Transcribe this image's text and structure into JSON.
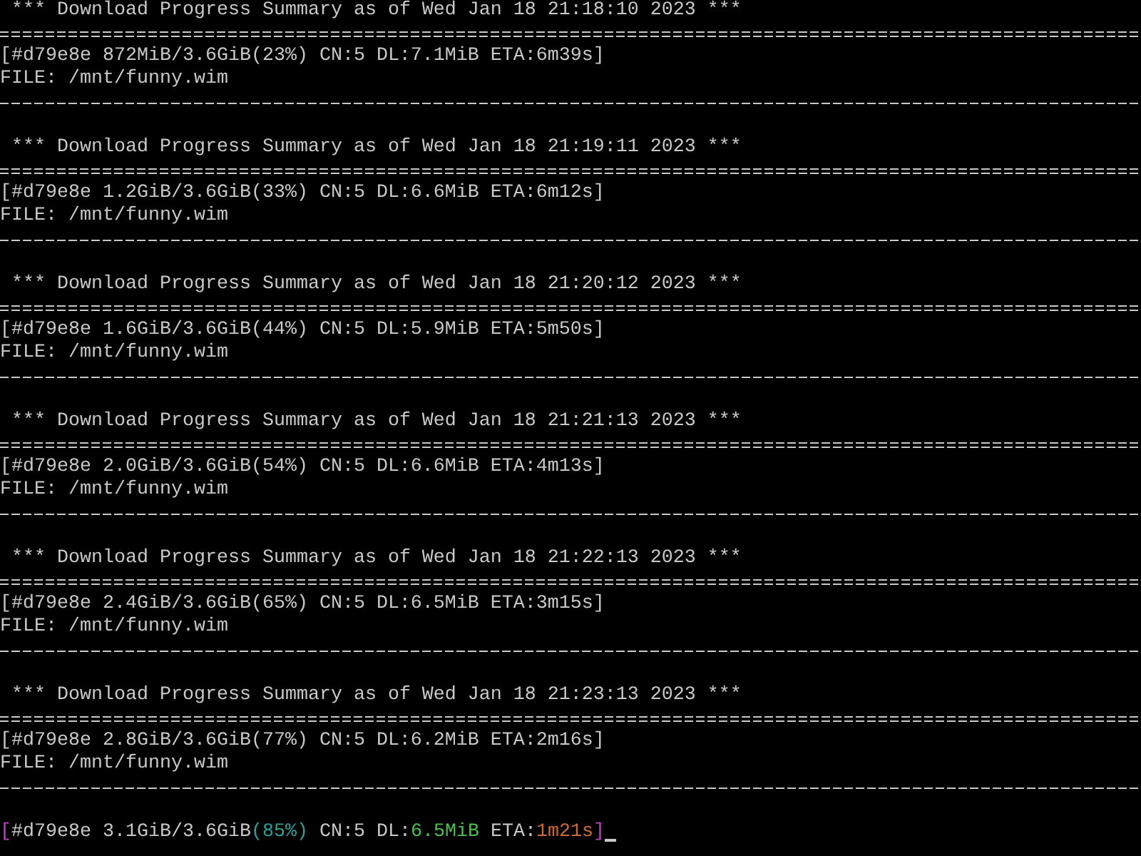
{
  "terminal": {
    "summaries": [
      {
        "header": "*** Download Progress Summary as of Wed Jan 18 21:18:10 2023 ***",
        "status": "[#d79e8e 872MiB/3.6GiB(23%) CN:5 DL:7.1MiB ETA:6m39s]",
        "file": "FILE: /mnt/funny.wim"
      },
      {
        "header": "*** Download Progress Summary as of Wed Jan 18 21:19:11 2023 ***",
        "status": "[#d79e8e 1.2GiB/3.6GiB(33%) CN:5 DL:6.6MiB ETA:6m12s]",
        "file": "FILE: /mnt/funny.wim"
      },
      {
        "header": "*** Download Progress Summary as of Wed Jan 18 21:20:12 2023 ***",
        "status": "[#d79e8e 1.6GiB/3.6GiB(44%) CN:5 DL:5.9MiB ETA:5m50s]",
        "file": "FILE: /mnt/funny.wim"
      },
      {
        "header": "*** Download Progress Summary as of Wed Jan 18 21:21:13 2023 ***",
        "status": "[#d79e8e 2.0GiB/3.6GiB(54%) CN:5 DL:6.6MiB ETA:4m13s]",
        "file": "FILE: /mnt/funny.wim"
      },
      {
        "header": "*** Download Progress Summary as of Wed Jan 18 21:22:13 2023 ***",
        "status": "[#d79e8e 2.4GiB/3.6GiB(65%) CN:5 DL:6.5MiB ETA:3m15s]",
        "file": "FILE: /mnt/funny.wim"
      },
      {
        "header": "*** Download Progress Summary as of Wed Jan 18 21:23:13 2023 ***",
        "status": "[#d79e8e 2.8GiB/3.6GiB(77%) CN:5 DL:6.2MiB ETA:2m16s]",
        "file": "FILE: /mnt/funny.wim"
      }
    ],
    "live_status": [
      {
        "text": "[",
        "color": "#c040c0"
      },
      {
        "text": "#d79e8e 3.1GiB/3.6GiB",
        "color": "#c8c8c8"
      },
      {
        "text": "(85%)",
        "color": "#2aa198"
      },
      {
        "text": " CN:5 DL:",
        "color": "#c8c8c8"
      },
      {
        "text": "6.5MiB",
        "color": "#4cc04c"
      },
      {
        "text": " ETA:",
        "color": "#c8c8c8"
      },
      {
        "text": "1m21s",
        "color": "#d06a30"
      },
      {
        "text": "]",
        "color": "#c040c0"
      }
    ],
    "cursor": true
  }
}
